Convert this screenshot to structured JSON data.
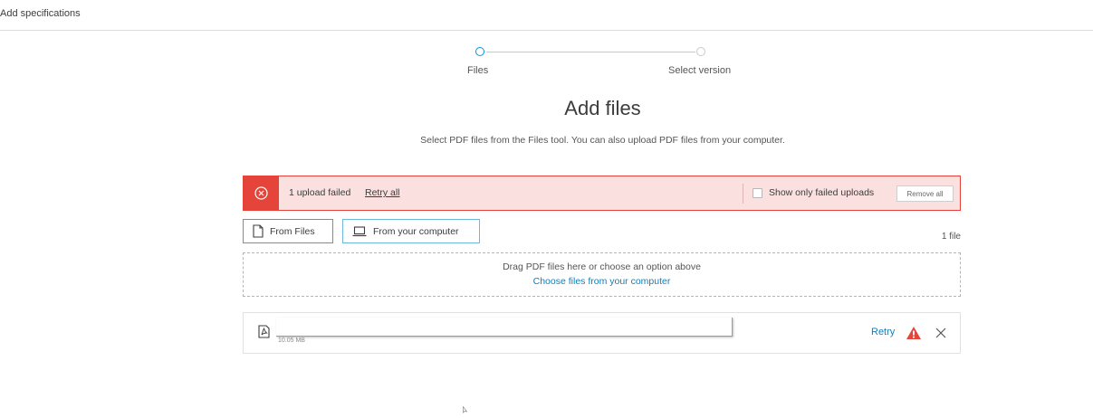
{
  "header": {
    "title": "Add specifications"
  },
  "stepper": {
    "steps": [
      {
        "label": "Files",
        "state": "active"
      },
      {
        "label": "Select version",
        "state": "inactive"
      }
    ],
    "active_color": "#0696d7"
  },
  "page": {
    "title": "Add files",
    "subtitle": "Select PDF files from the Files tool. You can also upload PDF files from your computer."
  },
  "banner": {
    "message": "1 upload failed",
    "retry_all": "Retry all",
    "show_only_failed": "Show only failed uploads",
    "show_only_failed_checked": false,
    "remove_all": "Remove all",
    "icon": "error-circle-x-icon",
    "color": "#e5443a"
  },
  "sources": {
    "from_files": "From Files",
    "from_files_icon": "document-icon",
    "from_computer": "From your computer",
    "from_computer_icon": "laptop-icon"
  },
  "file_count": "1 file",
  "dropzone": {
    "text": "Drag PDF files here or choose an option above",
    "link": "Choose files from your computer"
  },
  "files": [
    {
      "size": "10.05 MB",
      "icon": "pdf-icon",
      "retry": "Retry",
      "status_icon": "warning-triangle-icon",
      "status_color": "#e5443a"
    }
  ]
}
